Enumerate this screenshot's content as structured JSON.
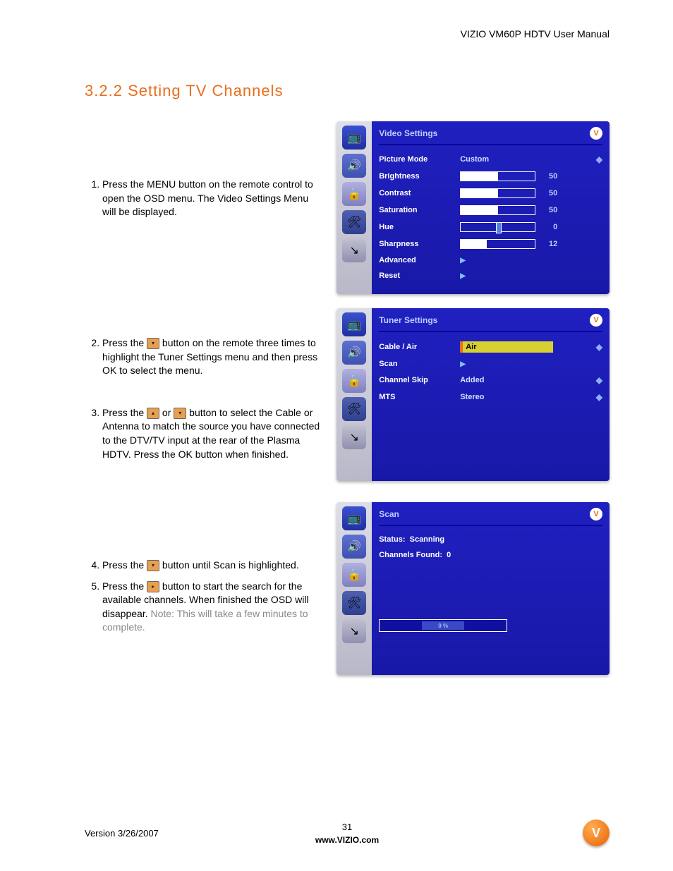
{
  "header": {
    "doc_title": "VIZIO VM60P HDTV User Manual"
  },
  "section": {
    "number": "3.2.2",
    "title": "Setting TV Channels"
  },
  "steps": [
    {
      "n": "1.",
      "text": "Press the MENU button on the remote control to open the OSD menu.  The Video Settings Menu will be displayed."
    },
    {
      "n": "2.",
      "text_a": "Press the ",
      "text_b": " button on the remote three times to highlight the Tuner Settings menu and then press OK to select the menu."
    },
    {
      "n": "3.",
      "text_a": "Press the ",
      "text_mid": " or ",
      "text_b": " button to select the Cable or Antenna to match the source you have connected to the DTV/TV input at the rear of the Plasma HDTV.  Press the OK button when finished."
    },
    {
      "n": "4.",
      "text_a": "Press the ",
      "text_b": " button until Scan is highlighted."
    },
    {
      "n": "5.",
      "text_a": "Press the ",
      "text_b": " button to start the search for the available channels.  When finished the OSD will disappear.  ",
      "note": "Note: This will take a few minutes to complete."
    }
  ],
  "osd1": {
    "title": "Video Settings",
    "rows": [
      {
        "label": "Picture Mode",
        "value": "Custom",
        "type": "value"
      },
      {
        "label": "Brightness",
        "num": "50",
        "fill": 50,
        "type": "slider"
      },
      {
        "label": "Contrast",
        "num": "50",
        "fill": 50,
        "type": "slider"
      },
      {
        "label": "Saturation",
        "num": "50",
        "fill": 50,
        "type": "slider"
      },
      {
        "label": "Hue",
        "num": "0",
        "thumb": 50,
        "type": "slider-center"
      },
      {
        "label": "Sharpness",
        "num": "12",
        "fill": 35,
        "type": "slider"
      },
      {
        "label": "Advanced",
        "type": "arrow"
      },
      {
        "label": "Reset",
        "type": "arrow"
      }
    ]
  },
  "osd2": {
    "title": "Tuner Settings",
    "rows": [
      {
        "label": "Cable / Air",
        "value": "Air",
        "type": "highlight"
      },
      {
        "label": "Scan",
        "type": "arrow"
      },
      {
        "label": "Channel Skip",
        "value": "Added",
        "type": "value"
      },
      {
        "label": "MTS",
        "value": "Stereo",
        "type": "value"
      }
    ]
  },
  "osd3": {
    "title": "Scan",
    "status_label": "Status:",
    "status_value": "Scanning",
    "found_label": "Channels Found:",
    "found_value": "0",
    "progress": "0 %"
  },
  "footer": {
    "version": "Version 3/26/2007",
    "page": "31",
    "url": "www.VIZIO.com"
  }
}
